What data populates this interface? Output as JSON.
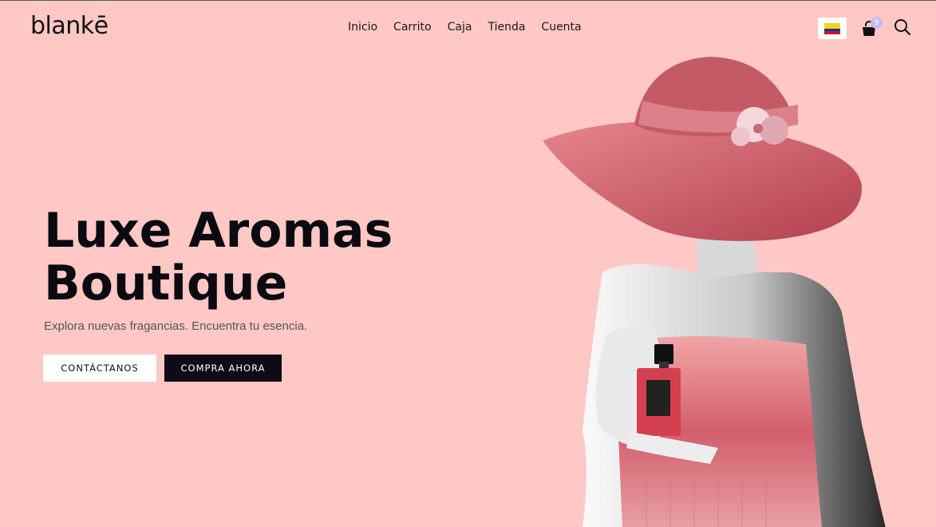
{
  "header": {
    "logo": "blankē",
    "nav": [
      "Inicio",
      "Carrito",
      "Caja",
      "Tienda",
      "Cuenta"
    ],
    "country_flag": "colombia-flag",
    "cart_count": "9"
  },
  "hero": {
    "title_line1": "Luxe Aromas",
    "title_line2": "Boutique",
    "subtitle": "Explora nuevas fragancias. Encuentra tu esencia.",
    "contact_label": "CONTÁCTANOS",
    "buy_label": "COMPRA AHORA"
  },
  "colors": {
    "background": "#ffc8c5",
    "primary_dark": "#0c0b16",
    "badge": "#c6b8f0"
  }
}
